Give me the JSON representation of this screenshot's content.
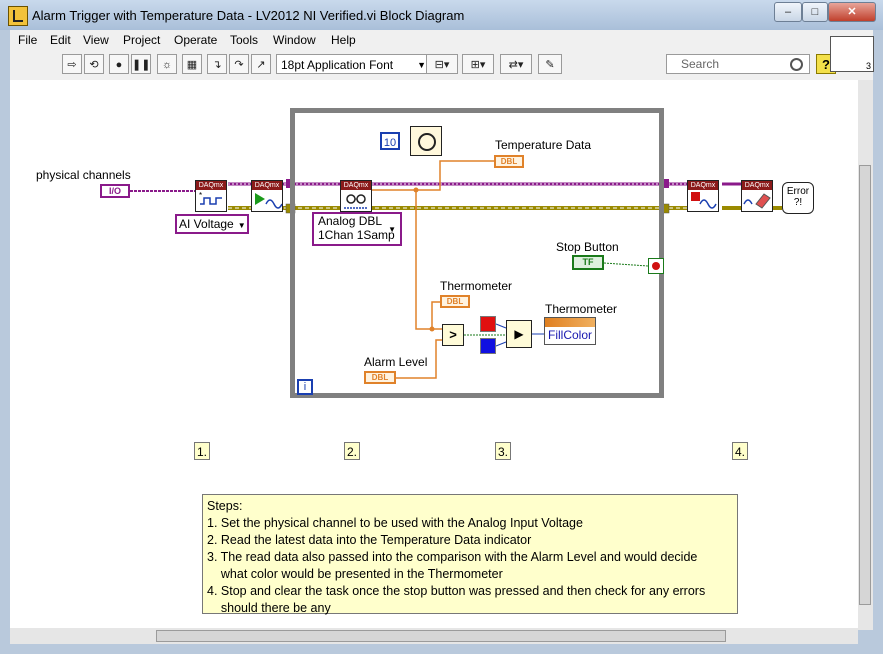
{
  "window": {
    "title": "Alarm Trigger with Temperature Data - LV2012 NI Verified.vi Block Diagram",
    "minimize_glyph": "–",
    "maximize_glyph": "□",
    "close_glyph": "✕"
  },
  "menu": [
    "File",
    "Edit",
    "View",
    "Project",
    "Operate",
    "Tools",
    "Window",
    "Help"
  ],
  "toolbar": {
    "font_value": "18pt Application Font",
    "search_placeholder": "Search",
    "help_glyph": "?",
    "vi_icon_number": "3"
  },
  "diagram": {
    "physical_channels_label": "physical channels",
    "io_constant": "I/O",
    "ai_voltage_ring": "AI Voltage",
    "read_ring_line1": "Analog DBL",
    "read_ring_line2": "1Chan 1Samp",
    "wait_constant": "10",
    "temperature_data_label": "Temperature Data",
    "thermometer_label": "Thermometer",
    "thermometer_property_label": "Thermometer",
    "fillcolor_property": "FillColor",
    "alarm_level_label": "Alarm Level",
    "stop_button_label": "Stop Button",
    "tf_terminal": "TF",
    "dbl_terminal": "DBL",
    "daqmx_header": "DAQmx",
    "iteration_terminal": "i",
    "error_text": "Error ?!",
    "compare_glyph": ">",
    "select_glyph": "▶"
  },
  "steps": [
    "1.",
    "2.",
    "3.",
    "4."
  ],
  "notes": [
    "Steps:",
    "1. Set the physical channel to be used with the Analog Input Voltage",
    "2. Read the latest data into the Temperature Data indicator",
    "3. The read data also passed into the comparison with the Alarm Level and would decide",
    "    what color would be presented in the Thermometer",
    "4. Stop and clear the task once the stop button was pressed and then check for any errors",
    "    should there be any"
  ],
  "colors": {
    "task_wire": "#8a1a8a",
    "error_wire": "#9a8a00",
    "dbl_wire": "#e0822a",
    "bool_wire": "#1a7a1a",
    "loop_border": "#808080"
  }
}
